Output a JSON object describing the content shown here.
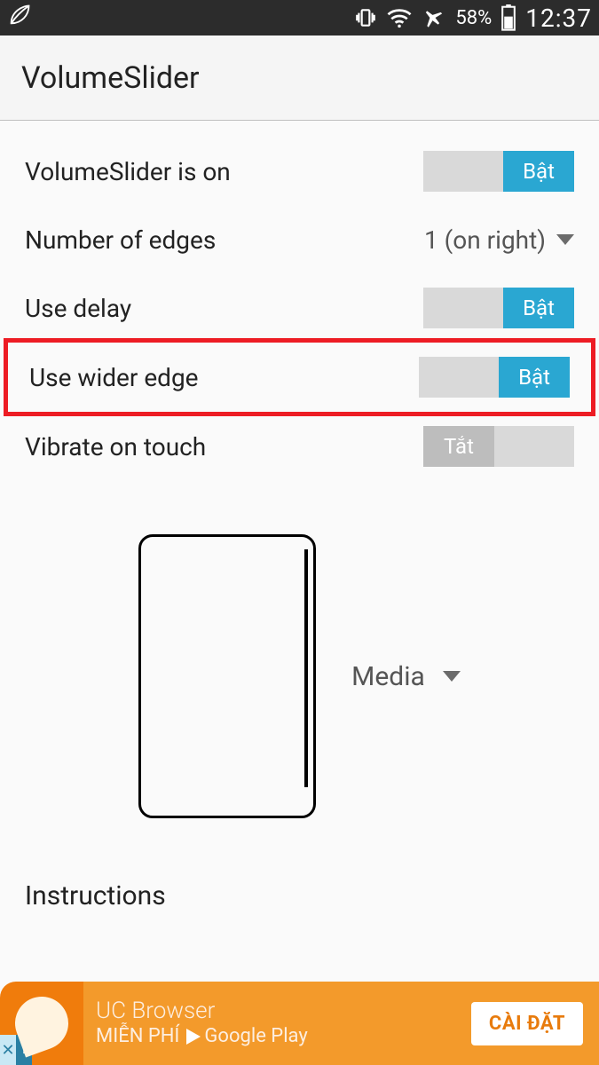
{
  "status": {
    "battery_pct": "58%",
    "time": "12:37"
  },
  "app": {
    "title": "VolumeSlider"
  },
  "settings": {
    "slider_on": {
      "label": "VolumeSlider is on",
      "toggle": "Bật",
      "state": "on"
    },
    "edges": {
      "label": "Number of edges",
      "value": "1 (on right)"
    },
    "delay": {
      "label": "Use delay",
      "toggle": "Bật",
      "state": "on"
    },
    "wider": {
      "label": "Use wider edge",
      "toggle": "Bật",
      "state": "on"
    },
    "vibrate": {
      "label": "Vibrate on touch",
      "toggle": "Tắt",
      "state": "off"
    }
  },
  "media_dropdown": {
    "value": "Media"
  },
  "instructions_label": "Instructions",
  "ad": {
    "title": "UC Browser",
    "subtitle": "MIỄN PHÍ",
    "store": "Google Play",
    "cta": "CÀI ĐẶT"
  }
}
